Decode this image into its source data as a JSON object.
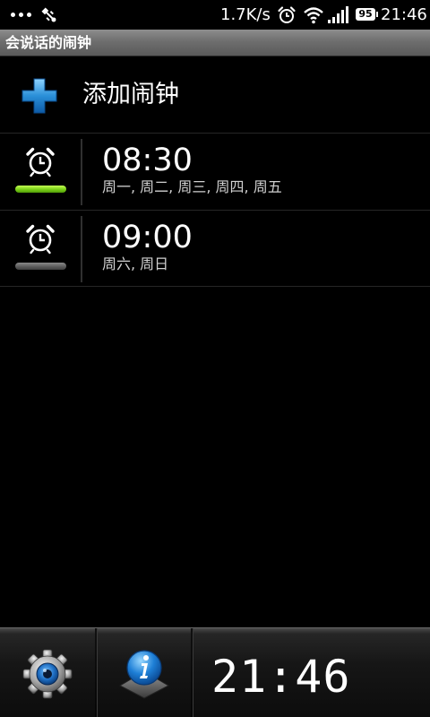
{
  "status_bar": {
    "net_speed": "1.7K/s",
    "battery_level": "95",
    "time": "21:46",
    "icons": [
      "more-dots-icon",
      "usb-icon",
      "alarm-icon",
      "wifi-icon",
      "signal-icon",
      "battery-icon"
    ]
  },
  "app": {
    "title": "会说话的闹钟"
  },
  "add_alarm": {
    "label": "添加闹钟",
    "icon": "plus-icon",
    "icon_color": "#2a8fd8"
  },
  "alarms": [
    {
      "time": "08:30",
      "days": "周一, 周二, 周三, 周四, 周五",
      "enabled": true,
      "indicator_color": "#7ad018"
    },
    {
      "time": "09:00",
      "days": "周六, 周日",
      "enabled": false,
      "indicator_color": "#6a6a6a"
    }
  ],
  "bottom_bar": {
    "clock": "21:46",
    "buttons": [
      "settings-icon",
      "info-icon"
    ]
  }
}
